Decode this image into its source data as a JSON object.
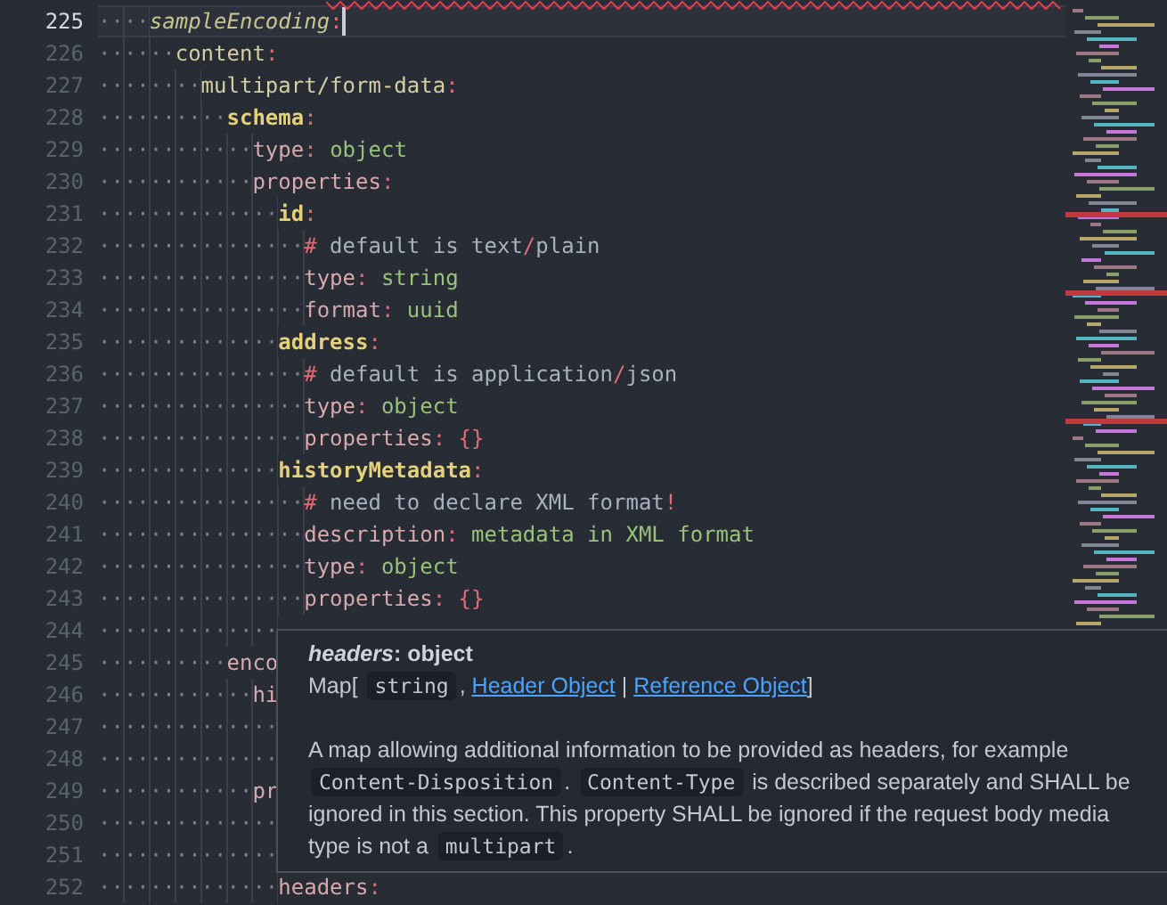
{
  "editor": {
    "lines": [
      {
        "number": "225",
        "current": true,
        "tokens": [
          {
            "kind": "ws",
            "text": "····"
          },
          {
            "kind": "key-italic",
            "text": "sampleEncoding"
          },
          {
            "kind": "punct",
            "text": ":"
          }
        ]
      },
      {
        "number": "226",
        "current": false,
        "tokens": [
          {
            "kind": "ws",
            "text": "······"
          },
          {
            "kind": "key-plain",
            "text": "content"
          },
          {
            "kind": "punct",
            "text": ":"
          }
        ]
      },
      {
        "number": "227",
        "current": false,
        "tokens": [
          {
            "kind": "ws",
            "text": "········"
          },
          {
            "kind": "key-plain",
            "text": "multipart/form-data"
          },
          {
            "kind": "punct",
            "text": ":"
          }
        ]
      },
      {
        "number": "228",
        "current": false,
        "tokens": [
          {
            "kind": "ws",
            "text": "··········"
          },
          {
            "kind": "key-bold",
            "text": "schema"
          },
          {
            "kind": "punct",
            "text": ":"
          }
        ]
      },
      {
        "number": "229",
        "current": false,
        "tokens": [
          {
            "kind": "ws",
            "text": "············"
          },
          {
            "kind": "key",
            "text": "type"
          },
          {
            "kind": "punct",
            "text": ":"
          },
          {
            "kind": "value",
            "text": " object"
          }
        ]
      },
      {
        "number": "230",
        "current": false,
        "tokens": [
          {
            "kind": "ws",
            "text": "············"
          },
          {
            "kind": "key",
            "text": "properties"
          },
          {
            "kind": "punct",
            "text": ":"
          }
        ]
      },
      {
        "number": "231",
        "current": false,
        "tokens": [
          {
            "kind": "ws",
            "text": "··············"
          },
          {
            "kind": "key-bold",
            "text": "id"
          },
          {
            "kind": "punct",
            "text": ":"
          }
        ]
      },
      {
        "number": "232",
        "current": false,
        "tokens": [
          {
            "kind": "ws",
            "text": "················"
          },
          {
            "kind": "punct",
            "text": "#"
          },
          {
            "kind": "comment",
            "text": " default is text"
          },
          {
            "kind": "punct",
            "text": "/"
          },
          {
            "kind": "comment",
            "text": "plain"
          }
        ]
      },
      {
        "number": "233",
        "current": false,
        "tokens": [
          {
            "kind": "ws",
            "text": "················"
          },
          {
            "kind": "key",
            "text": "type"
          },
          {
            "kind": "punct",
            "text": ":"
          },
          {
            "kind": "value",
            "text": " string"
          }
        ]
      },
      {
        "number": "234",
        "current": false,
        "tokens": [
          {
            "kind": "ws",
            "text": "················"
          },
          {
            "kind": "key",
            "text": "format"
          },
          {
            "kind": "punct",
            "text": ":"
          },
          {
            "kind": "value",
            "text": " uuid"
          }
        ]
      },
      {
        "number": "235",
        "current": false,
        "tokens": [
          {
            "kind": "ws",
            "text": "··············"
          },
          {
            "kind": "key-bold",
            "text": "address"
          },
          {
            "kind": "punct",
            "text": ":"
          }
        ]
      },
      {
        "number": "236",
        "current": false,
        "tokens": [
          {
            "kind": "ws",
            "text": "················"
          },
          {
            "kind": "punct",
            "text": "#"
          },
          {
            "kind": "comment",
            "text": " default is application"
          },
          {
            "kind": "punct",
            "text": "/"
          },
          {
            "kind": "comment",
            "text": "json"
          }
        ]
      },
      {
        "number": "237",
        "current": false,
        "tokens": [
          {
            "kind": "ws",
            "text": "················"
          },
          {
            "kind": "key",
            "text": "type"
          },
          {
            "kind": "punct",
            "text": ":"
          },
          {
            "kind": "value",
            "text": " object"
          }
        ]
      },
      {
        "number": "238",
        "current": false,
        "tokens": [
          {
            "kind": "ws",
            "text": "················"
          },
          {
            "kind": "key",
            "text": "properties"
          },
          {
            "kind": "punct",
            "text": ": {}"
          }
        ]
      },
      {
        "number": "239",
        "current": false,
        "tokens": [
          {
            "kind": "ws",
            "text": "··············"
          },
          {
            "kind": "key-bold",
            "text": "historyMetadata"
          },
          {
            "kind": "punct",
            "text": ":"
          }
        ]
      },
      {
        "number": "240",
        "current": false,
        "tokens": [
          {
            "kind": "ws",
            "text": "················"
          },
          {
            "kind": "punct",
            "text": "#"
          },
          {
            "kind": "comment",
            "text": " need to declare XML format"
          },
          {
            "kind": "punct",
            "text": "!"
          }
        ]
      },
      {
        "number": "241",
        "current": false,
        "tokens": [
          {
            "kind": "ws",
            "text": "················"
          },
          {
            "kind": "key",
            "text": "description"
          },
          {
            "kind": "punct",
            "text": ":"
          },
          {
            "kind": "value",
            "text": " metadata in XML format"
          }
        ]
      },
      {
        "number": "242",
        "current": false,
        "tokens": [
          {
            "kind": "ws",
            "text": "················"
          },
          {
            "kind": "key",
            "text": "type"
          },
          {
            "kind": "punct",
            "text": ":"
          },
          {
            "kind": "value",
            "text": " object"
          }
        ]
      },
      {
        "number": "243",
        "current": false,
        "tokens": [
          {
            "kind": "ws",
            "text": "················"
          },
          {
            "kind": "key",
            "text": "properties"
          },
          {
            "kind": "punct",
            "text": ": {}"
          }
        ]
      },
      {
        "number": "244",
        "current": false,
        "tokens": [
          {
            "kind": "ws",
            "text": "··············"
          }
        ]
      },
      {
        "number": "245",
        "current": false,
        "tokens": [
          {
            "kind": "ws",
            "text": "··········"
          },
          {
            "kind": "key",
            "text": "enco"
          }
        ]
      },
      {
        "number": "246",
        "current": false,
        "tokens": [
          {
            "kind": "ws",
            "text": "············"
          },
          {
            "kind": "key",
            "text": "hi"
          }
        ]
      },
      {
        "number": "247",
        "current": false,
        "tokens": [
          {
            "kind": "ws",
            "text": "··············"
          }
        ]
      },
      {
        "number": "248",
        "current": false,
        "tokens": [
          {
            "kind": "ws",
            "text": "··············"
          }
        ]
      },
      {
        "number": "249",
        "current": false,
        "tokens": [
          {
            "kind": "ws",
            "text": "············"
          },
          {
            "kind": "key",
            "text": "pr"
          }
        ]
      },
      {
        "number": "250",
        "current": false,
        "tokens": [
          {
            "kind": "ws",
            "text": "··············"
          }
        ]
      },
      {
        "number": "251",
        "current": false,
        "tokens": [
          {
            "kind": "ws",
            "text": "··············"
          }
        ]
      },
      {
        "number": "252",
        "current": false,
        "tokens": [
          {
            "kind": "ws",
            "text": "··············"
          },
          {
            "kind": "key",
            "text": "headers"
          },
          {
            "kind": "punct",
            "text": ":"
          }
        ]
      }
    ]
  },
  "hover": {
    "title": "*headers*: object",
    "signature": [
      {
        "kind": "text",
        "text": "Map["
      },
      {
        "kind": "code",
        "text": "string"
      },
      {
        "kind": "text",
        "text": ","
      },
      {
        "kind": "link",
        "text": "Header Object"
      },
      {
        "kind": "text",
        "text": "|"
      },
      {
        "kind": "link",
        "text": "Reference Object"
      },
      {
        "kind": "text",
        "text": "]"
      }
    ],
    "description": [
      {
        "kind": "text",
        "text": "A map allowing additional information to be provided as headers, for example"
      },
      {
        "kind": "code",
        "text": "Content-Disposition"
      },
      {
        "kind": "text",
        "text": "."
      },
      {
        "kind": "code",
        "text": "Content-Type"
      },
      {
        "kind": "text",
        "text": "is described separately and SHALL be ignored in this section. This property SHALL be ignored if the request body media type is not a"
      },
      {
        "kind": "code",
        "text": "multipart"
      },
      {
        "kind": "text",
        "text": "."
      }
    ]
  }
}
